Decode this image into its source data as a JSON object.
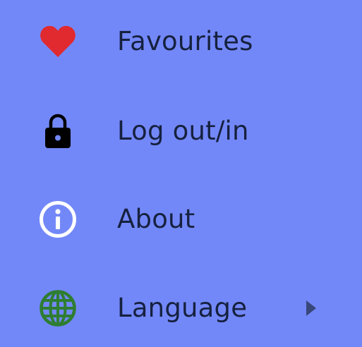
{
  "menu": {
    "items": [
      {
        "label": "Favourites",
        "icon": "heart-icon",
        "icon_color": "#E02A2F"
      },
      {
        "label": "Log out/in",
        "icon": "lock-icon",
        "icon_color": "#000000"
      },
      {
        "label": "About",
        "icon": "info-icon",
        "icon_color": "#FFFFFF"
      },
      {
        "label": "Language",
        "icon": "globe-icon",
        "icon_color": "#2E7D32",
        "has_submenu": true,
        "submenu_indicator": "chevron-right-icon"
      }
    ]
  },
  "colors": {
    "background": "#7388F8",
    "text": "#16213F",
    "chevron": "#38477A"
  }
}
